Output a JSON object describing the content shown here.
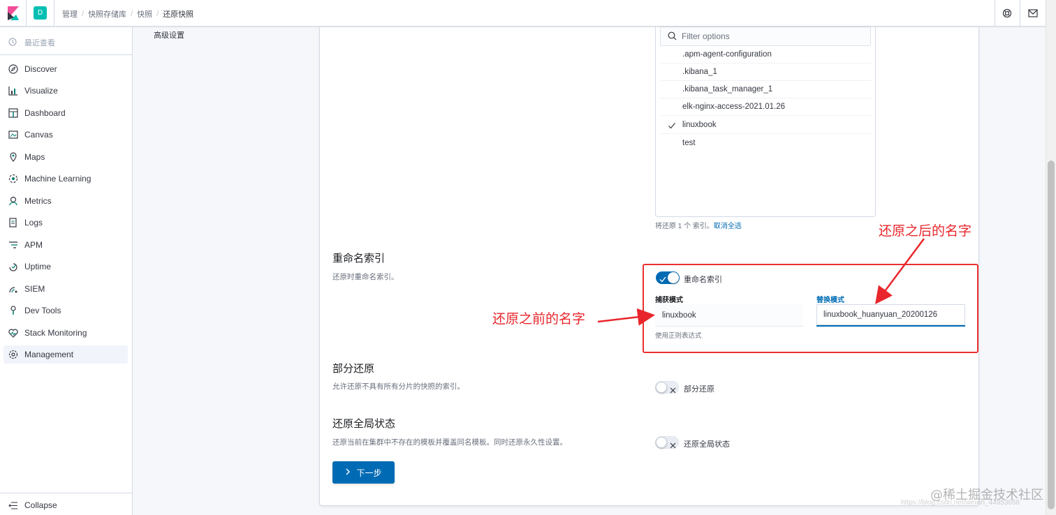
{
  "header": {
    "space_initial": "D",
    "breadcrumbs": [
      "管理",
      "快照存储库",
      "快照",
      "还原快照"
    ]
  },
  "sidebar": {
    "recent_label": "最近查看",
    "items": [
      {
        "label": "Discover",
        "icon": "compass-icon"
      },
      {
        "label": "Visualize",
        "icon": "chart-icon"
      },
      {
        "label": "Dashboard",
        "icon": "dashboard-icon"
      },
      {
        "label": "Canvas",
        "icon": "canvas-icon"
      },
      {
        "label": "Maps",
        "icon": "map-pin-icon"
      },
      {
        "label": "Machine Learning",
        "icon": "machine-learning-icon"
      },
      {
        "label": "Metrics",
        "icon": "metrics-icon"
      },
      {
        "label": "Logs",
        "icon": "logs-icon"
      },
      {
        "label": "APM",
        "icon": "apm-icon"
      },
      {
        "label": "Uptime",
        "icon": "uptime-icon"
      },
      {
        "label": "SIEM",
        "icon": "siem-icon"
      },
      {
        "label": "Dev Tools",
        "icon": "dev-tools-icon"
      },
      {
        "label": "Stack Monitoring",
        "icon": "monitoring-icon"
      },
      {
        "label": "Management",
        "icon": "gear-icon",
        "active": true
      }
    ],
    "collapse_label": "Collapse"
  },
  "subnav": {
    "advanced_settings": "高级设置"
  },
  "index_selector": {
    "search_placeholder": "Filter options",
    "options": [
      {
        "label": ".apm-agent-configuration",
        "checked": false
      },
      {
        "label": ".kibana_1",
        "checked": false
      },
      {
        "label": ".kibana_task_manager_1",
        "checked": false
      },
      {
        "label": "elk-nginx-access-2021.01.26",
        "checked": false
      },
      {
        "label": "linuxbook",
        "checked": true
      },
      {
        "label": "test",
        "checked": false
      }
    ],
    "help_text": "将还原 1 个 索引。",
    "deselect_all": "取消全选"
  },
  "rename_section": {
    "title": "重命名索引",
    "description": "还原时重命名索引。",
    "toggle_label": "重命名索引",
    "toggle_on": true,
    "capture_label": "捕获模式",
    "capture_value": "linuxbook",
    "capture_help": "使用正则表达式",
    "replace_label": "替换模式",
    "replace_value": "linuxbook_huanyuan_20200126"
  },
  "partial_section": {
    "title": "部分还原",
    "description": "允许还原不具有所有分片的快照的索引。",
    "toggle_label": "部分还原",
    "toggle_on": false
  },
  "global_section": {
    "title": "还原全局状态",
    "description": "还原当前在集群中不存在的模板并覆盖同名模板。同时还原永久性设置。",
    "toggle_label": "还原全局状态",
    "toggle_on": false
  },
  "next_button": {
    "label": "下一步"
  },
  "annotations": {
    "after_name": "还原之后的名字",
    "before_name": "还原之前的名字",
    "color": "#e8262b"
  },
  "watermark": {
    "brand": "@稀土掘金技术社区",
    "url": "https://blog.csdn.net/weixin_44953658"
  },
  "colors": {
    "accent": "#006bb4",
    "space_badge": "#00bfb3"
  }
}
